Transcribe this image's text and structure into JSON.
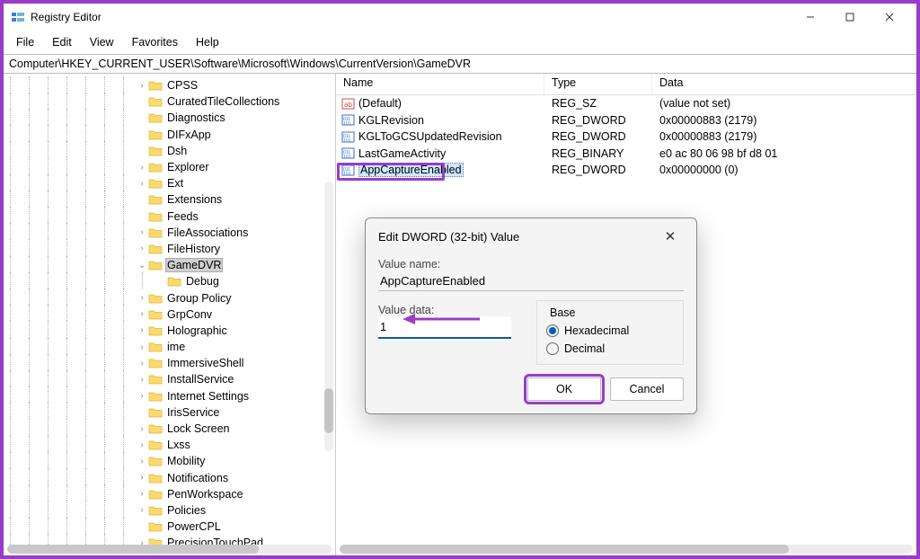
{
  "window": {
    "title": "Registry Editor"
  },
  "menu": [
    "File",
    "Edit",
    "View",
    "Favorites",
    "Help"
  ],
  "address": "Computer\\HKEY_CURRENT_USER\\Software\\Microsoft\\Windows\\CurrentVersion\\GameDVR",
  "tree": [
    {
      "indent": 7,
      "twisty": ">",
      "label": "CPSS"
    },
    {
      "indent": 7,
      "twisty": "",
      "label": "CuratedTileCollections"
    },
    {
      "indent": 7,
      "twisty": "",
      "label": "Diagnostics"
    },
    {
      "indent": 7,
      "twisty": "",
      "label": "DIFxApp"
    },
    {
      "indent": 7,
      "twisty": "",
      "label": "Dsh"
    },
    {
      "indent": 7,
      "twisty": ">",
      "label": "Explorer"
    },
    {
      "indent": 7,
      "twisty": ">",
      "label": "Ext"
    },
    {
      "indent": 7,
      "twisty": "",
      "label": "Extensions"
    },
    {
      "indent": 7,
      "twisty": "",
      "label": "Feeds"
    },
    {
      "indent": 7,
      "twisty": ">",
      "label": "FileAssociations"
    },
    {
      "indent": 7,
      "twisty": ">",
      "label": "FileHistory"
    },
    {
      "indent": 7,
      "twisty": "v",
      "label": "GameDVR",
      "selected": true
    },
    {
      "indent": 8,
      "twisty": "",
      "label": "Debug"
    },
    {
      "indent": 7,
      "twisty": ">",
      "label": "Group Policy"
    },
    {
      "indent": 7,
      "twisty": ">",
      "label": "GrpConv"
    },
    {
      "indent": 7,
      "twisty": ">",
      "label": "Holographic"
    },
    {
      "indent": 7,
      "twisty": ">",
      "label": "ime"
    },
    {
      "indent": 7,
      "twisty": ">",
      "label": "ImmersiveShell"
    },
    {
      "indent": 7,
      "twisty": ">",
      "label": "InstallService"
    },
    {
      "indent": 7,
      "twisty": ">",
      "label": "Internet Settings"
    },
    {
      "indent": 7,
      "twisty": "",
      "label": "IrisService"
    },
    {
      "indent": 7,
      "twisty": ">",
      "label": "Lock Screen"
    },
    {
      "indent": 7,
      "twisty": ">",
      "label": "Lxss"
    },
    {
      "indent": 7,
      "twisty": ">",
      "label": "Mobility"
    },
    {
      "indent": 7,
      "twisty": ">",
      "label": "Notifications"
    },
    {
      "indent": 7,
      "twisty": ">",
      "label": "PenWorkspace"
    },
    {
      "indent": 7,
      "twisty": ">",
      "label": "Policies"
    },
    {
      "indent": 7,
      "twisty": "",
      "label": "PowerCPL"
    },
    {
      "indent": 7,
      "twisty": ">",
      "label": "PrecisionTouchPad"
    }
  ],
  "list": {
    "headers": {
      "name": "Name",
      "type": "Type",
      "data": "Data"
    },
    "rows": [
      {
        "icon": "string",
        "name": "(Default)",
        "type": "REG_SZ",
        "data": "(value not set)"
      },
      {
        "icon": "dword",
        "name": "KGLRevision",
        "type": "REG_DWORD",
        "data": "0x00000883 (2179)"
      },
      {
        "icon": "dword",
        "name": "KGLToGCSUpdatedRevision",
        "type": "REG_DWORD",
        "data": "0x00000883 (2179)"
      },
      {
        "icon": "binary",
        "name": "LastGameActivity",
        "type": "REG_BINARY",
        "data": "e0 ac 80 06 98 bf d8 01"
      },
      {
        "icon": "dword",
        "name": "AppCaptureEnabled",
        "type": "REG_DWORD",
        "data": "0x00000000 (0)",
        "selected": true,
        "highlighted": true
      }
    ]
  },
  "dialog": {
    "title": "Edit DWORD (32-bit) Value",
    "value_name_label": "Value name:",
    "value_name": "AppCaptureEnabled",
    "value_data_label": "Value data:",
    "value_data": "1",
    "base_label": "Base",
    "base_hex": "Hexadecimal",
    "base_dec": "Decimal",
    "ok": "OK",
    "cancel": "Cancel"
  }
}
